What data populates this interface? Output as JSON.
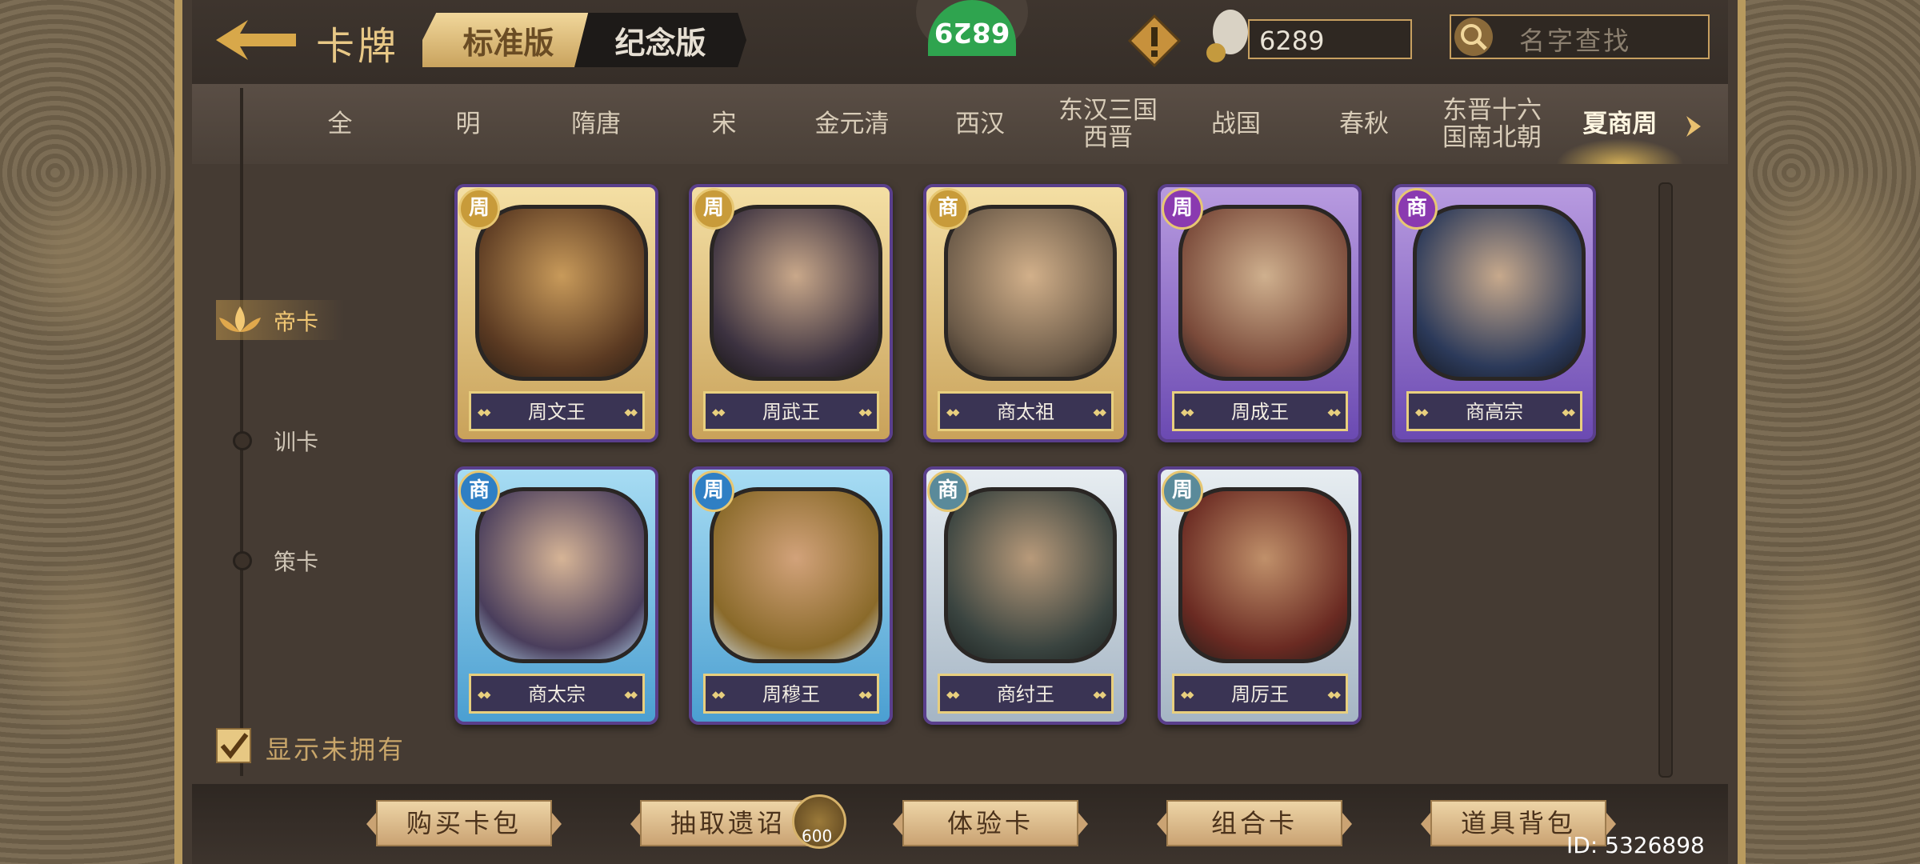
{
  "header": {
    "title": "卡牌",
    "edition_tabs": [
      {
        "label": "标准版",
        "active": true
      },
      {
        "label": "纪念版",
        "active": false
      }
    ],
    "top_badge": "6829",
    "currency": "6289",
    "search_placeholder": "名字查找"
  },
  "eras": [
    {
      "label": "全"
    },
    {
      "label": "明"
    },
    {
      "label": "隋唐"
    },
    {
      "label": "宋"
    },
    {
      "label": "金元清"
    },
    {
      "label": "西汉"
    },
    {
      "label": "东汉三国\n西晋"
    },
    {
      "label": "战国"
    },
    {
      "label": "春秋"
    },
    {
      "label": "东晋十六\n国南北朝"
    },
    {
      "label": "夏商周",
      "active": true
    }
  ],
  "categories": [
    {
      "label": "帝卡",
      "active": true
    },
    {
      "label": "训卡",
      "active": false
    },
    {
      "label": "策卡",
      "active": false
    }
  ],
  "cards": [
    {
      "name": "周文王",
      "dynasty": "周",
      "rarity": "gold"
    },
    {
      "name": "周武王",
      "dynasty": "周",
      "rarity": "gold"
    },
    {
      "name": "商太祖",
      "dynasty": "商",
      "rarity": "gold"
    },
    {
      "name": "周成王",
      "dynasty": "周",
      "rarity": "purple"
    },
    {
      "name": "商高宗",
      "dynasty": "商",
      "rarity": "purple"
    },
    {
      "name": "商太宗",
      "dynasty": "商",
      "rarity": "blue"
    },
    {
      "name": "周穆王",
      "dynasty": "周",
      "rarity": "blue"
    },
    {
      "name": "商纣王",
      "dynasty": "商",
      "rarity": "silver"
    },
    {
      "name": "周厉王",
      "dynasty": "周",
      "rarity": "silver"
    }
  ],
  "show_unowned": {
    "label": "显示未拥有",
    "checked": true
  },
  "bottom_buttons": [
    {
      "label": "购买卡包"
    },
    {
      "label": "抽取遗诏"
    },
    {
      "label": "体验卡"
    },
    {
      "label": "组合卡"
    },
    {
      "label": "道具背包"
    }
  ],
  "draw_cost": "600",
  "user_id": "ID: 5326898",
  "colors": {
    "accent_gold": "#e8c886",
    "dynasty_zhou": "#c89b3a",
    "dynasty_shang": "#8a3ab0"
  }
}
